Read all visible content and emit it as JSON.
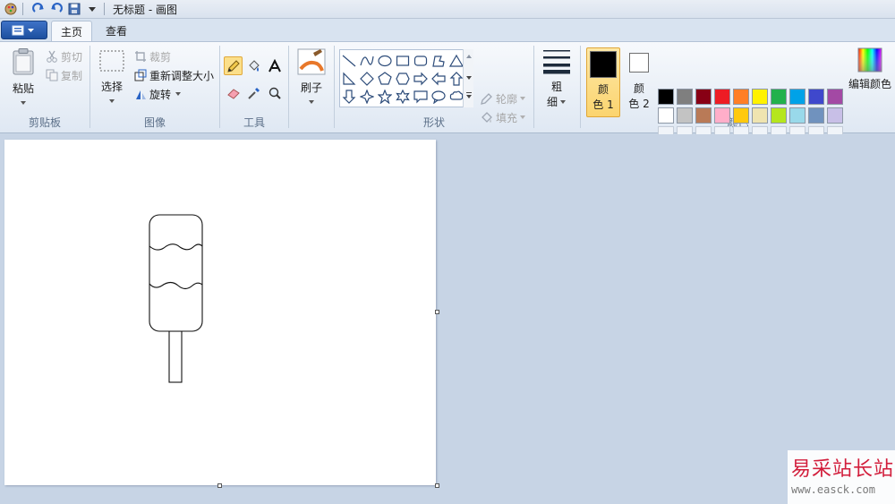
{
  "window": {
    "title": "无标题 - 画图"
  },
  "tabs": {
    "home": "主页",
    "view": "查看"
  },
  "clipboard": {
    "paste": "粘贴",
    "cut": "剪切",
    "copy": "复制",
    "group_label": "剪贴板"
  },
  "image": {
    "select": "选择",
    "crop": "裁剪",
    "resize": "重新调整大小",
    "rotate": "旋转",
    "group_label": "图像"
  },
  "tools": {
    "group_label": "工具"
  },
  "brushes": {
    "label": "刷子"
  },
  "shapes": {
    "outline": "轮廓",
    "fill": "填充",
    "group_label": "形状"
  },
  "size": {
    "label_line1": "粗",
    "label_line2": "细"
  },
  "colors": {
    "color1_line1": "颜",
    "color1_line2": "色 1",
    "color2_line1": "颜",
    "color2_line2": "色 2",
    "edit_colors": "编辑颜色",
    "group_label": "颜色",
    "color1_value": "#000000",
    "color2_value": "#ffffff",
    "palette_row1": [
      "#000000",
      "#7f7f7f",
      "#880015",
      "#ed1c24",
      "#ff7f27",
      "#fff200",
      "#22b14c",
      "#00a2e8",
      "#3f48cc",
      "#a349a4"
    ],
    "palette_row2": [
      "#ffffff",
      "#c3c3c3",
      "#b97a57",
      "#ffaec9",
      "#ffc90e",
      "#efe4b0",
      "#b5e61d",
      "#99d9ea",
      "#7092be",
      "#c8bfe7"
    ],
    "palette_row3": [
      "#f0f4f9",
      "#f0f4f9",
      "#f0f4f9",
      "#f0f4f9",
      "#f0f4f9",
      "#f0f4f9",
      "#f0f4f9",
      "#f0f4f9",
      "#f0f4f9",
      "#f0f4f9"
    ]
  },
  "watermark": {
    "name": "易采站长站",
    "url": "www.easck.com"
  }
}
